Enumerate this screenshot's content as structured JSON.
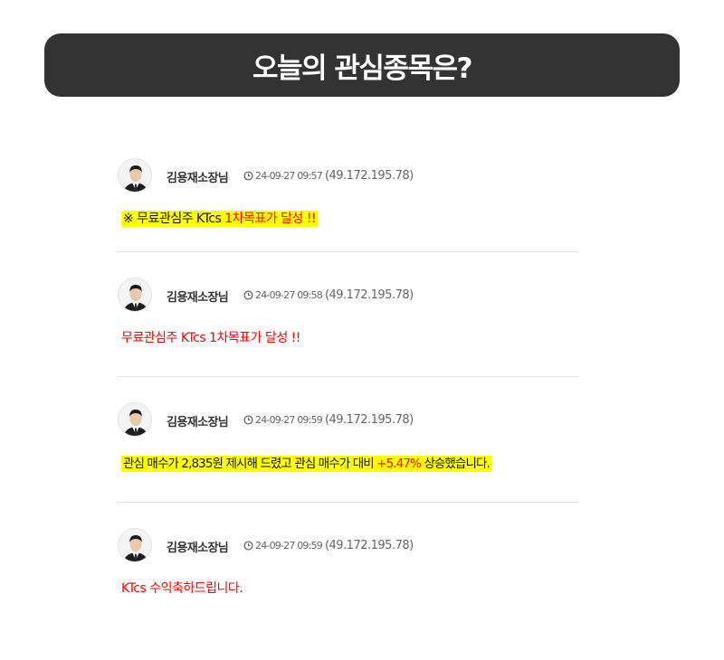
{
  "banner": {
    "title": "오늘의 관심종목은?"
  },
  "comments": [
    {
      "author": "김용재소장님",
      "datetime": "24-09-27 09:57",
      "ip": "(49.172.195.78)",
      "text_parts": [
        "※ 무료관심주 KTcs ",
        "1차목표가 달성 !!"
      ]
    },
    {
      "author": "김용재소장님",
      "datetime": "24-09-27 09:58",
      "ip": "(49.172.195.78)",
      "text": "무료관심주 KTcs 1차목표가 달성 !!"
    },
    {
      "author": "김용재소장님",
      "datetime": "24-09-27 09:59",
      "ip": "(49.172.195.78)",
      "text_parts": [
        "관심 매수가 2,835원 제시해 드렸고 관심 매수가 대비 ",
        "+5.47%",
        " 상승했습니다."
      ]
    },
    {
      "author": "김용재소장님",
      "datetime": "24-09-27 09:59",
      "ip": "(49.172.195.78)",
      "text": "KTcs 수익축하드립니다."
    }
  ],
  "colors": {
    "banner_bg": "#333333",
    "highlight": "#ffff00",
    "accent_red": "#ff0000"
  },
  "icons": {
    "clock": "clock-icon",
    "avatar": "avatar"
  }
}
